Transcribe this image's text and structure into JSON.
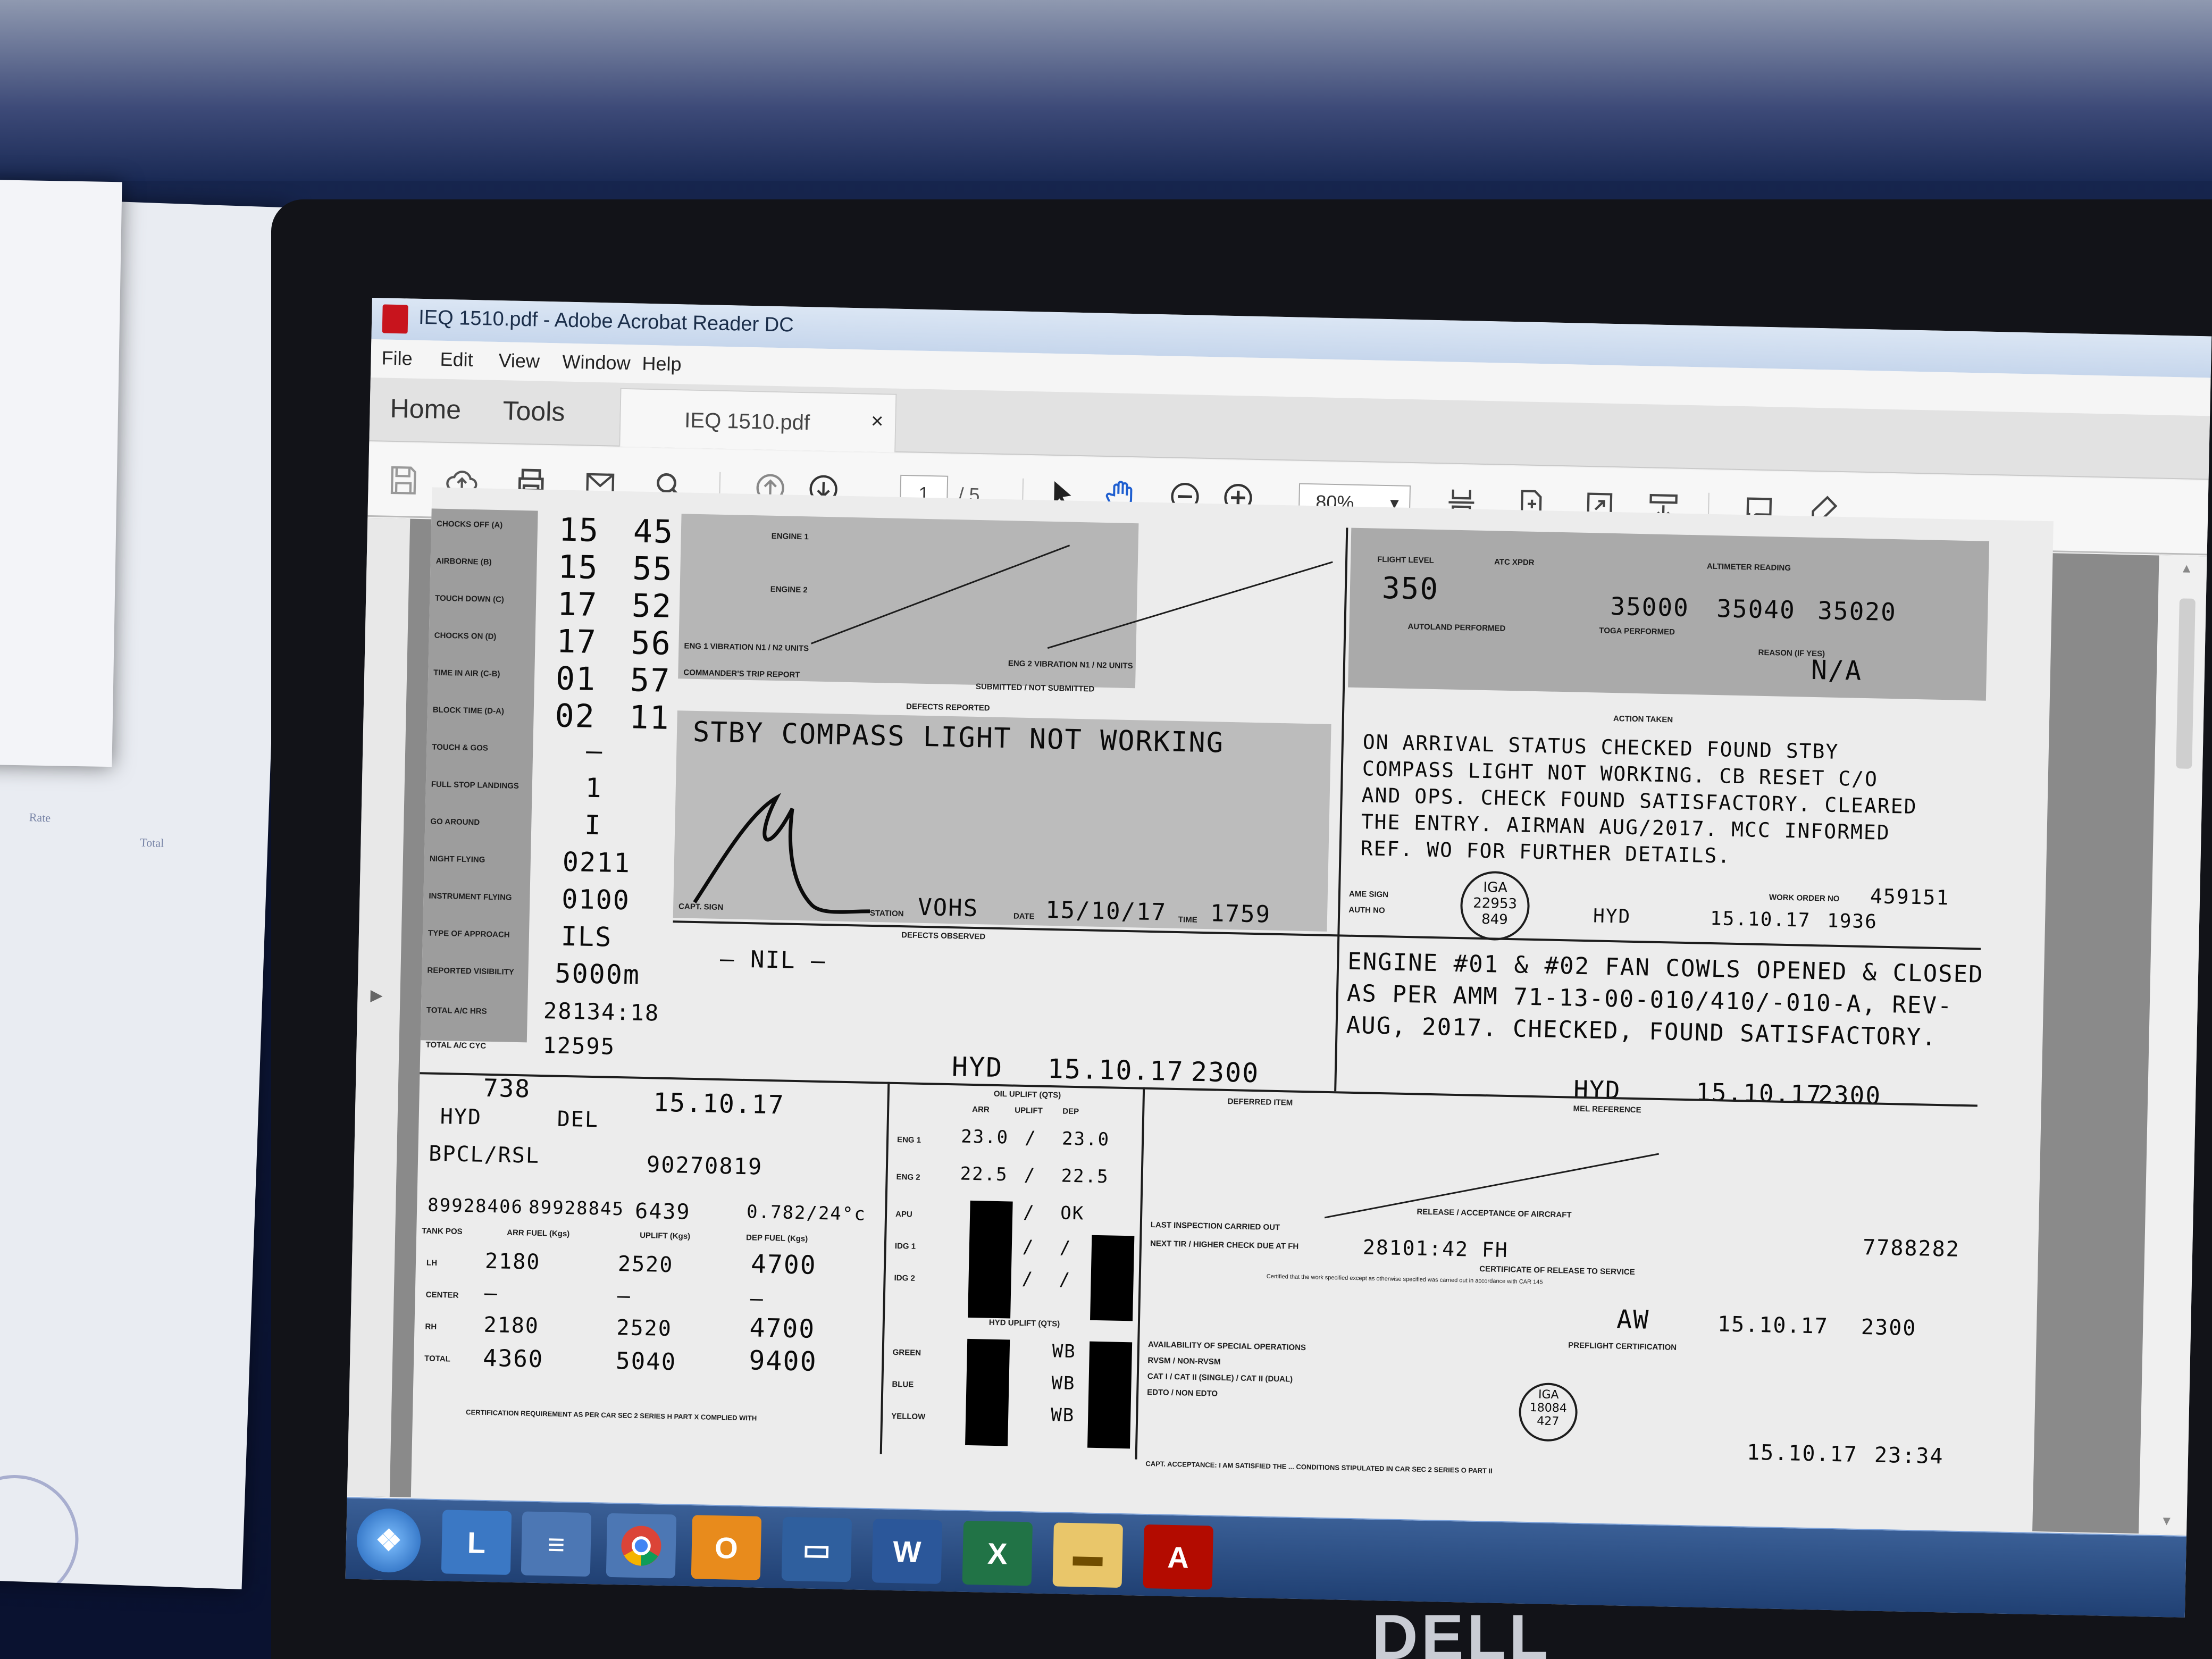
{
  "window": {
    "title": "IEQ 1510.pdf - Adobe Acrobat Reader DC"
  },
  "menu": [
    "File",
    "Edit",
    "View",
    "Window",
    "Help"
  ],
  "nav": {
    "home": "Home",
    "tools": "Tools"
  },
  "tab": {
    "label": "IEQ 1510.pdf",
    "close": "×"
  },
  "toolbar": {
    "page_current": "1",
    "page_total": "/ 5",
    "zoom": "80%"
  },
  "monitor_brand": "DELL",
  "document": {
    "times": [
      {
        "label": "CHOCKS OFF (A)",
        "h": "15",
        "m": "45"
      },
      {
        "label": "AIRBORNE (B)",
        "h": "15",
        "m": "55"
      },
      {
        "label": "TOUCH DOWN (C)",
        "h": "17",
        "m": "52"
      },
      {
        "label": "CHOCKS ON (D)",
        "h": "17",
        "m": "56"
      },
      {
        "label": "TIME IN AIR (C-B)",
        "h": "01",
        "m": "57"
      },
      {
        "label": "BLOCK TIME (D-A)",
        "h": "02",
        "m": "11"
      }
    ],
    "counts": [
      {
        "label": "TOUCH & GOS",
        "value": "—"
      },
      {
        "label": "FULL STOP LANDINGS",
        "value": "1"
      },
      {
        "label": "GO AROUND",
        "value": "I"
      },
      {
        "label": "NIGHT FLYING",
        "value": "0211"
      },
      {
        "label": "INSTRUMENT FLYING",
        "value": "0100"
      },
      {
        "label": "TYPE OF APPROACH",
        "value": "ILS"
      },
      {
        "label": "REPORTED VISIBILITY",
        "value": "5000m"
      },
      {
        "label": "TOTAL A/C HRS",
        "value": "28134:18"
      },
      {
        "label": "TOTAL A/C CYC",
        "value": "12595"
      }
    ],
    "engine_labels": [
      "ENGINE 1",
      "ENGINE 2"
    ],
    "eng_vibration": "ENG 1 VIBRATION N1 / N2 UNITS",
    "eng2_vibration": "ENG 2 VIBRATION N1 / N2 UNITS",
    "commanders_trip_report": "COMMANDER'S TRIP REPORT",
    "submitted": "SUBMITTED / NOT SUBMITTED",
    "defects_reported_header": "DEFECTS REPORTED",
    "defect_text": "STBY COMPASS LIGHT NOT WORKING",
    "capt_sign_label": "CAPT. SIGN",
    "station_label": "STATION",
    "date_label": "DATE",
    "time_label": "TIME",
    "defect_station": "VOHS",
    "defect_date": "15/10/17",
    "defect_time": "1759",
    "flight_level_header": "FLIGHT LEVEL",
    "flight_level": "350",
    "alt_readings": [
      "35000",
      "35040",
      "35020"
    ],
    "atc_xpdr": "ATC XPDR",
    "altimeter_reading": "ALTIMETER READING",
    "autoland": "AUTOLAND PERFORMED",
    "toga": "TOGA PERFORMED",
    "reason": "REASON (IF YES)",
    "na": "N/A",
    "action_taken_header": "ACTION TAKEN",
    "action_lines": [
      "ON ARRIVAL STATUS CHECKED FOUND STBY",
      "COMPASS LIGHT NOT WORKING. CB RESET C/O",
      "AND OPS. CHECK FOUND SATISFACTORY. CLEARED",
      "THE ENTRY. AIRMAN AUG/2017. MCC INFORMED",
      "REF. WO FOR FURTHER DETAILS."
    ],
    "ame_sign_label": "AME SIGN",
    "auth_no_label": "AUTH NO",
    "stamp1": {
      "line1": "IGA",
      "line2": "22953",
      "line3": "849"
    },
    "action1_station": "HYD",
    "action1_date": "15.10.17",
    "action1_time": "1936",
    "work_order_label": "WORK ORDER NO",
    "work_order": "459151",
    "defects_observed_header": "DEFECTS OBSERVED",
    "nil": "— NIL —",
    "action2_lines": [
      "ENGINE #01 & #02 FAN COWLS OPENED & CLOSED",
      "AS PER AMM 71-13-00-010/410/-010-A, REV-",
      "AUG, 2017. CHECKED, FOUND SATISFACTORY."
    ],
    "obs_station": "HYD",
    "obs_date": "15.10.17",
    "obs_time": "2300",
    "act2_station": "HYD",
    "act2_date": "15.10.17",
    "act2_time": "2300",
    "lt_no": "738",
    "from": "HYD",
    "to": "DEL",
    "fuel_date": "15.10.17",
    "fuel_company": "BPCL/RSL",
    "receipt_no": "90270819",
    "bowser_open": "89928406",
    "bowser_close": "89928845",
    "uplift_lts": "6439",
    "sp_gr": "0.782/24°c",
    "fuel_headers": [
      "TANK POS",
      "ARR FUEL (Kgs)",
      "UPLIFT (Kgs)",
      "DEP FUEL (Kgs)"
    ],
    "fuel_rows": [
      {
        "pos": "LH",
        "arr": "2180",
        "upl": "2520",
        "dep": "4700"
      },
      {
        "pos": "CENTER",
        "arr": "—",
        "upl": "—",
        "dep": "—"
      },
      {
        "pos": "RH",
        "arr": "2180",
        "upl": "2520",
        "dep": "4700"
      },
      {
        "pos": "TOTAL",
        "arr": "4360",
        "upl": "5040",
        "dep": "9400"
      }
    ],
    "oil_header": "OIL UPLIFT (QTS)",
    "oil_cols": [
      "ARR",
      "UPLIFT",
      "DEP"
    ],
    "oil_rows": [
      {
        "pos": "ENG 1",
        "arr": "23.0",
        "upl": "/",
        "dep": "23.0"
      },
      {
        "pos": "ENG 2",
        "arr": "22.5",
        "upl": "/",
        "dep": "22.5"
      },
      {
        "pos": "APU",
        "arr": "",
        "upl": "/",
        "dep": "OK"
      },
      {
        "pos": "IDG 1",
        "arr": "",
        "upl": "/",
        "dep": "/"
      },
      {
        "pos": "IDG 2",
        "arr": "",
        "upl": "/",
        "dep": "/"
      }
    ],
    "hyd_header": "HYD UPLIFT (QTS)",
    "hyd_rows": [
      {
        "pos": "GREEN",
        "val": "WB"
      },
      {
        "pos": "BLUE",
        "val": "WB"
      },
      {
        "pos": "YELLOW",
        "val": "WB"
      }
    ],
    "deferred_item": "DEFERRED ITEM",
    "mel_ref": "MEL REFERENCE",
    "release_header": "RELEASE / ACCEPTANCE OF AIRCRAFT",
    "last_inspection": "LAST INSPECTION CARRIED OUT",
    "next_check": "NEXT TIR / HIGHER CHECK DUE AT FH",
    "next_check_val": "28101:42 FH",
    "release_wo": "7788282",
    "cert_release": "CERTIFICATE OF RELEASE TO SERVICE",
    "cert_text": "Certified that the work specified except as otherwise specified was carried out in accordance with CAR 145",
    "rel_time": "2300",
    "rel_date": "15.10.17",
    "stamp2": {
      "line1": "IGA",
      "line2": "18084",
      "line3": "427"
    },
    "special_ops": "AVAILABILITY OF SPECIAL OPERATIONS",
    "rvsm": "RVSM / NON-RVSM",
    "cat": "CAT I / CAT II (SINGLE) / CAT II (DUAL)",
    "edto": "EDTO / NON EDTO",
    "preflight_cert": "PREFLIGHT CERTIFICATION",
    "final_date": "15.10.17",
    "final_time": "23:34",
    "capt_accept": "CAPT. ACCEPTANCE: I AM SATISFIED THE ... CONDITIONS STIPULATED IN CAR SEC 2 SERIES O PART II",
    "bottom_cert": "CERTIFICATION REQUIREMENT AS PER CAR SEC 2 SERIES H PART X COMPLIED WITH",
    "aw_initials": "AW"
  }
}
